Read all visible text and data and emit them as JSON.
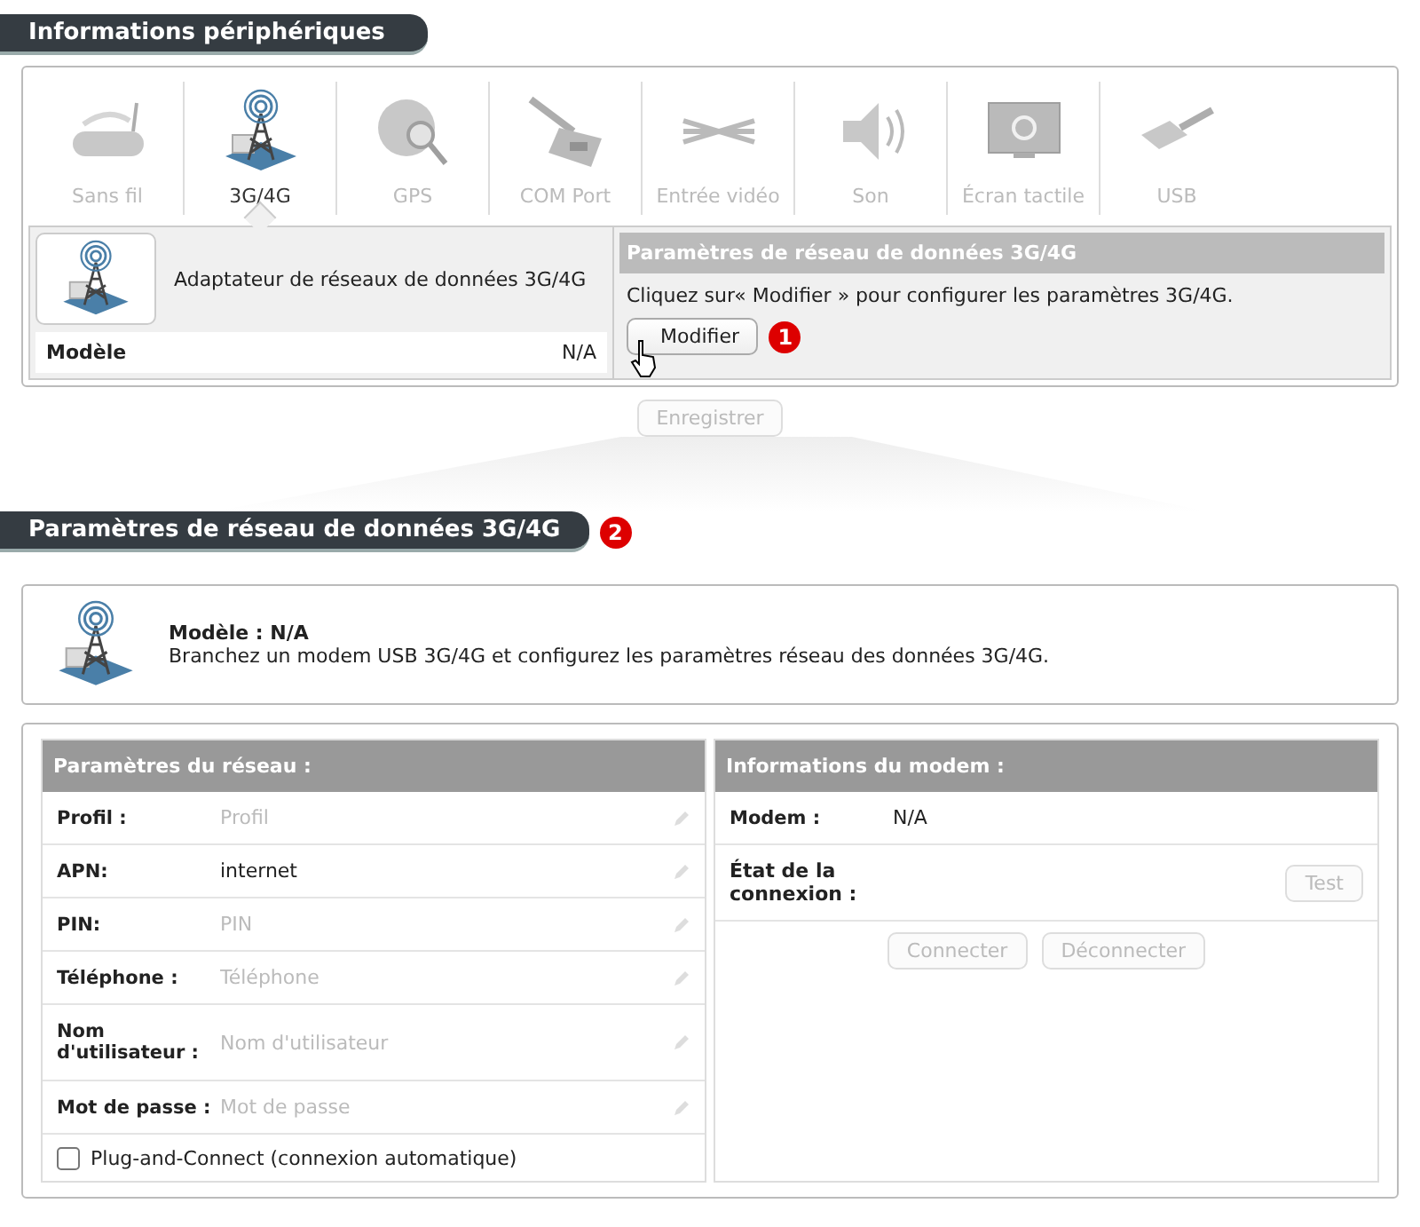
{
  "device_info": {
    "title": "Informations périphériques",
    "tabs": [
      {
        "label": "Sans fil",
        "selected": false
      },
      {
        "label": "3G/4G",
        "selected": true
      },
      {
        "label": "GPS",
        "selected": false
      },
      {
        "label": "COM Port",
        "selected": false
      },
      {
        "label": "Entrée vidéo",
        "selected": false
      },
      {
        "label": "Son",
        "selected": false
      },
      {
        "label": "Écran tactile",
        "selected": false
      },
      {
        "label": "USB",
        "selected": false
      }
    ],
    "adapter": {
      "name": "Adaptateur de réseaux de données 3G/4G",
      "model_label": "Modèle",
      "model_value": "N/A"
    },
    "settings_panel": {
      "header": "Paramètres de réseau de données 3G/4G",
      "hint": "Cliquez sur« Modifier » pour configurer les paramètres 3G/4G.",
      "button": {
        "label": "Modifier",
        "disabled": false
      },
      "badge": "1"
    },
    "save_button": {
      "label": "Enregistrer",
      "disabled": true
    }
  },
  "network_settings": {
    "title": "Paramètres de réseau de données 3G/4G",
    "badge": "2",
    "summary": {
      "model": "Modèle : N/A",
      "description": "Branchez un modem USB 3G/4G et configurez les paramètres réseau des données 3G/4G."
    },
    "network": {
      "header": "Paramètres du réseau :",
      "fields": [
        {
          "label": "Profil :",
          "placeholder": "Profil"
        },
        {
          "label": "APN:",
          "value": "internet"
        },
        {
          "label": "PIN:",
          "placeholder": "PIN"
        },
        {
          "label": "Téléphone :",
          "placeholder": "Téléphone"
        },
        {
          "label": "Nom d'utilisateur :",
          "placeholder": "Nom d'utilisateur"
        },
        {
          "label": "Mot de passe :",
          "placeholder": "Mot de passe"
        }
      ],
      "auto_connect": {
        "label": "Plug-and-Connect (connexion automatique)",
        "checked": false
      }
    },
    "modem": {
      "header": "Informations du modem :",
      "modem_label": "Modem :",
      "modem_value": "N/A",
      "status_label": "État de la connexion :",
      "test_button": {
        "label": "Test",
        "disabled": true
      },
      "buttons": [
        {
          "label": "Connecter",
          "disabled": true
        },
        {
          "label": "Déconnecter",
          "disabled": true
        }
      ]
    }
  }
}
